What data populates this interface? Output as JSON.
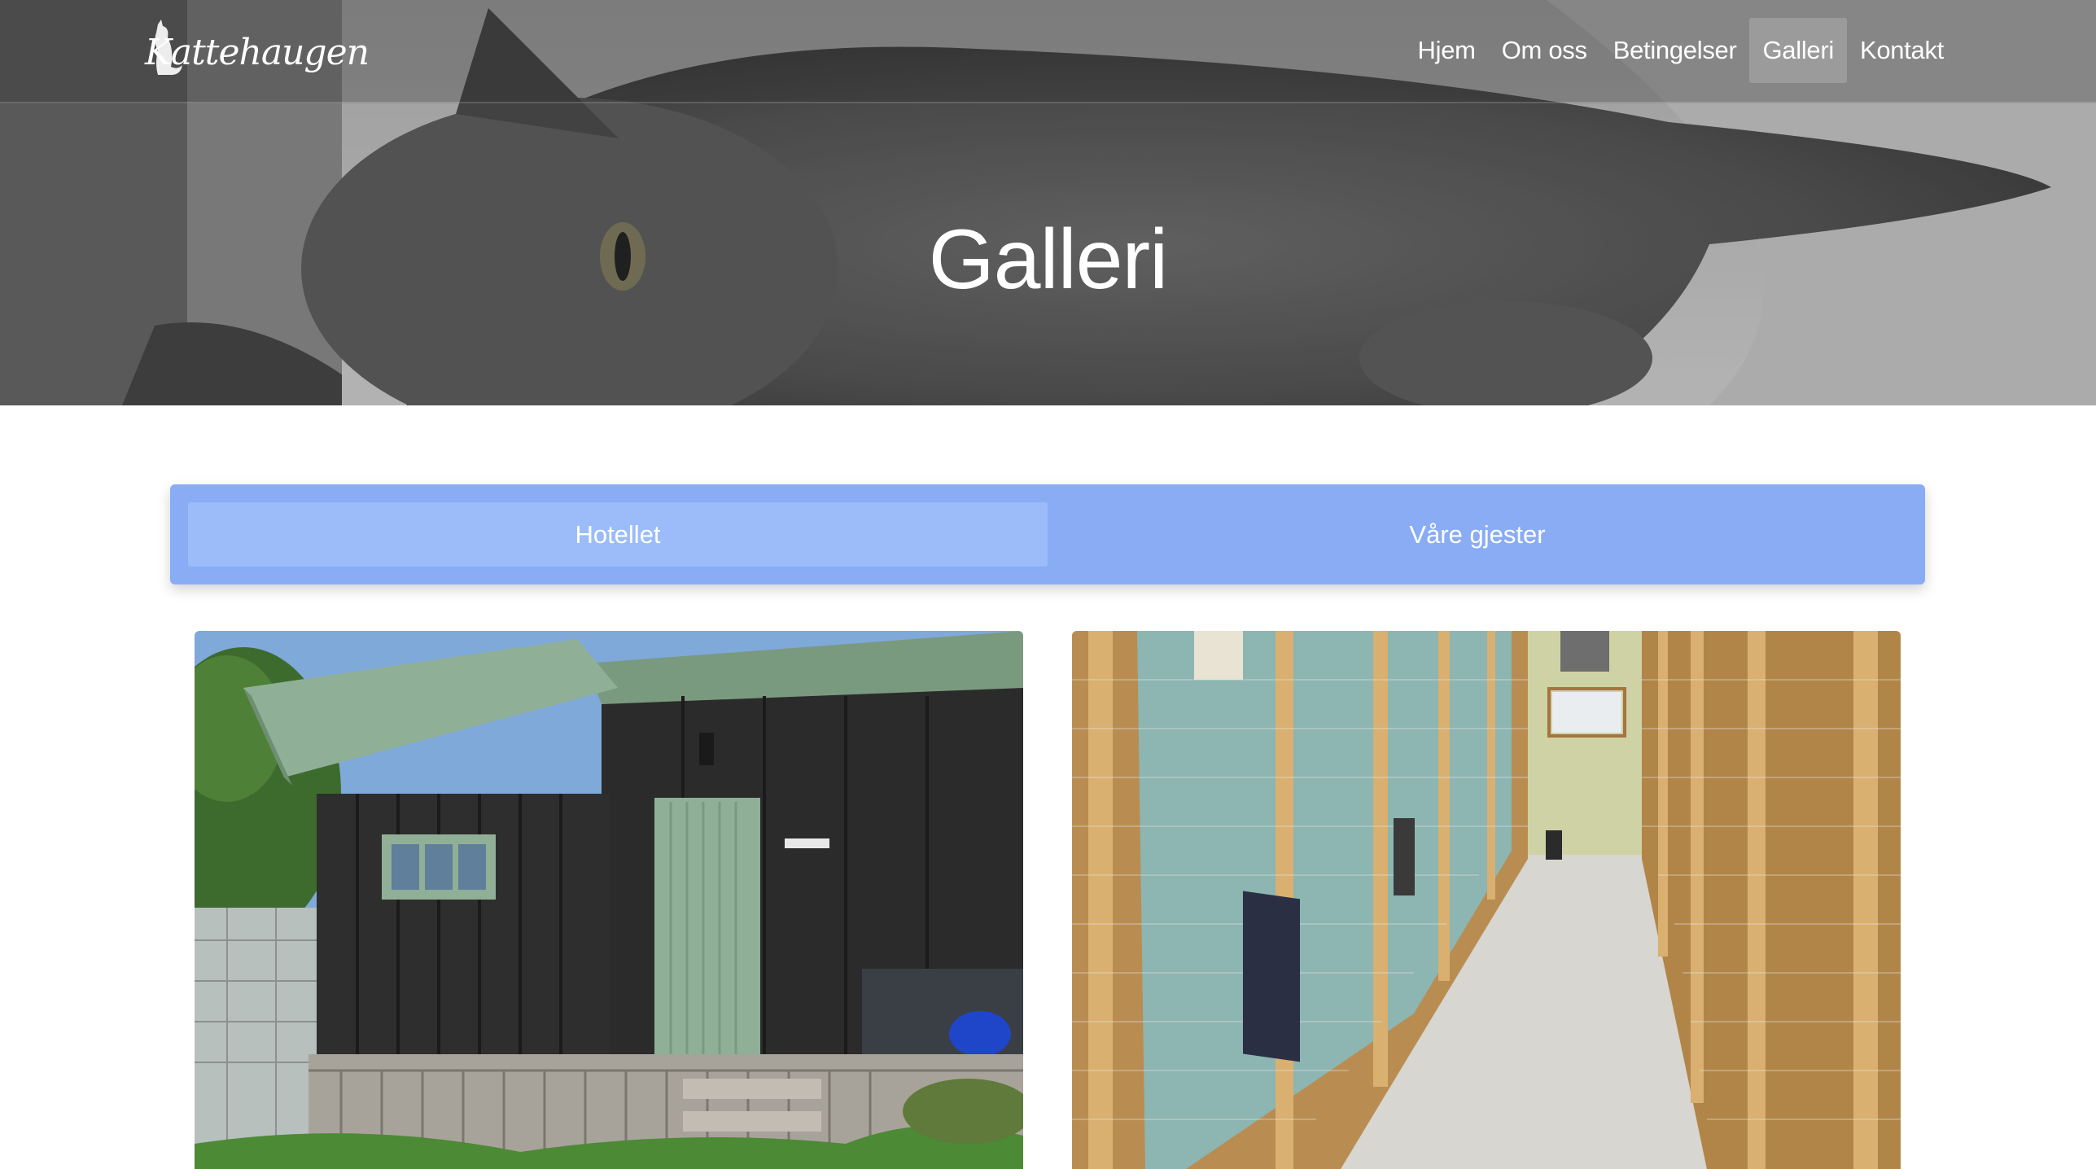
{
  "header": {
    "logo_text": "Kattehaugen",
    "nav": [
      {
        "label": "Hjem",
        "active": false
      },
      {
        "label": "Om oss",
        "active": false
      },
      {
        "label": "Betingelser",
        "active": false
      },
      {
        "label": "Galleri",
        "active": true
      },
      {
        "label": "Kontakt",
        "active": false
      }
    ]
  },
  "hero": {
    "title": "Galleri"
  },
  "tabs": [
    {
      "label": "Hotellet",
      "active": true
    },
    {
      "label": "Våre gjester",
      "active": false
    }
  ],
  "gallery": {
    "images": [
      {
        "subject": "exterior-building-photo"
      },
      {
        "subject": "interior-corridor-photo"
      }
    ]
  },
  "colors": {
    "tab_bar": "#89acf5",
    "tab_active": "#9bbcf8",
    "text_on_dark": "#ffffff"
  }
}
